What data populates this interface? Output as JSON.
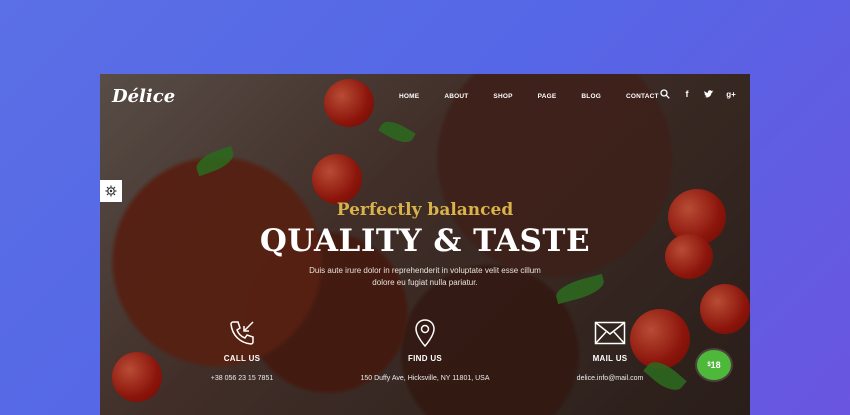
{
  "brand": {
    "logo": "Délice"
  },
  "nav": {
    "items": [
      "HOME",
      "ABOUT",
      "SHOP",
      "PAGE",
      "BLOG",
      "CONTACT"
    ]
  },
  "header_icons": [
    "search-icon",
    "facebook-icon",
    "twitter-icon",
    "google-plus-icon"
  ],
  "hero": {
    "subtitle": "Perfectly balanced",
    "title": "QUALITY & TASTE",
    "description": "Duis aute irure dolor in reprehenderit in voluptate velit esse cillum dolore eu fugiat nulla pariatur."
  },
  "contact": [
    {
      "label": "CALL US",
      "value": "+38 056 23 15 7851",
      "icon": "phone-icon"
    },
    {
      "label": "FIND US",
      "value": "150 Duffy Ave, Hicksville, NY 11801, USA",
      "icon": "map-pin-icon"
    },
    {
      "label": "MAIL US",
      "value": "delice.info@mail.com",
      "icon": "mail-icon"
    }
  ],
  "price_badge": {
    "currency": "$",
    "amount": "18"
  },
  "colors": {
    "accent_gold": "#d8b24a",
    "badge_green": "#4db83a",
    "page_bg": "#5b6fe6"
  }
}
